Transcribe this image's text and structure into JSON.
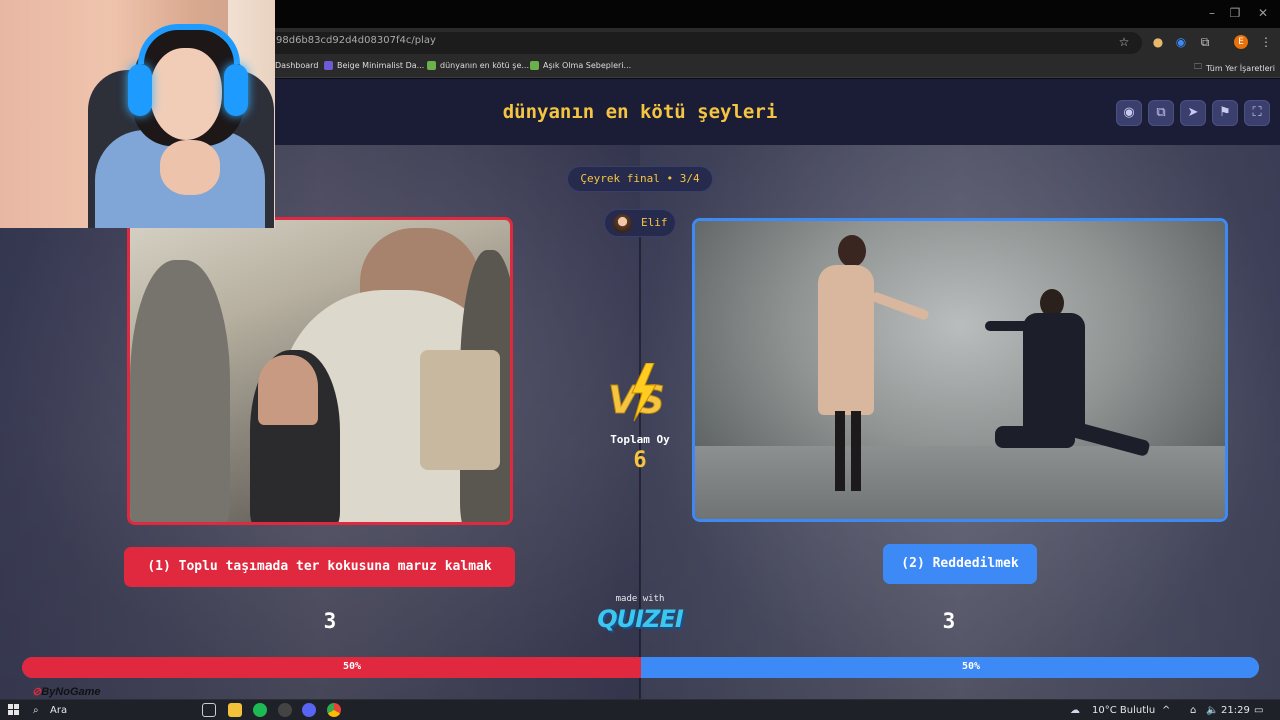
{
  "browser": {
    "url": "98d6b83cd92d4d08307f4c/play",
    "profile_initial": "E",
    "bookmarks": [
      "Dashboard",
      "Beige Minimalist Da...",
      "dünyanın en kötü şe...",
      "Aşık Olma Sebepleri..."
    ],
    "all_bookmarks_label": "Tüm Yer İşaretleri"
  },
  "header": {
    "title": "dünyanın en kötü şeyleri",
    "buttons": [
      "eye-icon",
      "copy-icon",
      "send-icon",
      "flag-icon",
      "fullscreen-icon"
    ]
  },
  "round": {
    "label": "Çeyrek final • 3/4"
  },
  "player": {
    "name": "Elif"
  },
  "options": {
    "left": {
      "label": "(1) Toplu taşımada ter kokusuna maruz kalmak",
      "votes": "3",
      "percent_label": "50%"
    },
    "right": {
      "label": "(2) Reddedilmek",
      "votes": "3",
      "percent_label": "50%"
    }
  },
  "vote_split": {
    "left_percent": 50,
    "right_percent": 50
  },
  "total": {
    "label": "Toplam Oy",
    "value": "6"
  },
  "branding": {
    "made_with": "made with",
    "logo": "QUIZEI",
    "watermark": "ByNoGame"
  },
  "taskbar": {
    "search_label": "Ara",
    "weather": "10°C  Bulutlu",
    "time": "21:29"
  },
  "colors": {
    "left_accent": "#e0283e",
    "right_accent": "#3d8af7",
    "title_accent": "#f5c542"
  }
}
